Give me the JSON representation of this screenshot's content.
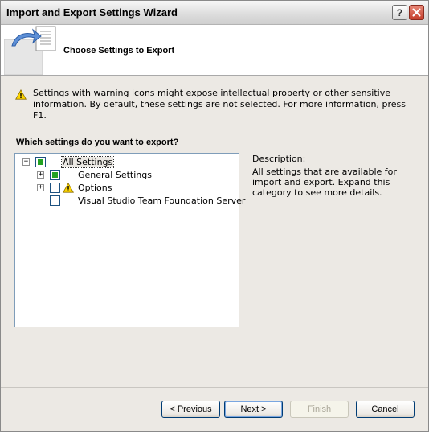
{
  "window": {
    "title": "Import and Export Settings Wizard"
  },
  "header": {
    "title": "Choose Settings to Export"
  },
  "warning": {
    "text": "Settings with warning icons might expose intellectual property or other sensitive information. By default, these settings are not selected. For more information, press F1."
  },
  "question": {
    "mnemonic": "W",
    "rest": "hich settings do you want to export?"
  },
  "tree": {
    "items": [
      {
        "label": "All Settings",
        "expander": "−",
        "check": "partial",
        "warning": false,
        "selected": true
      },
      {
        "label": "General Settings",
        "expander": "+",
        "check": "partial",
        "warning": false,
        "selected": false
      },
      {
        "label": "Options",
        "expander": "+",
        "check": "unchecked",
        "warning": true,
        "selected": false
      },
      {
        "label": "Visual Studio Team Foundation Server",
        "expander": "",
        "check": "unchecked",
        "warning": false,
        "selected": false
      }
    ]
  },
  "description": {
    "title": "Description:",
    "text": "All settings that are available for import and export. Expand this category to see more details."
  },
  "buttons": {
    "previous": {
      "prefix": "< ",
      "mnemonic": "P",
      "rest": "revious"
    },
    "next": {
      "mnemonic": "N",
      "rest": "ext >"
    },
    "finish": {
      "mnemonic": "F",
      "rest": "inish"
    },
    "cancel": {
      "label": "Cancel"
    }
  },
  "colors": {
    "accent_border": "#003c74",
    "check_fill": "#21a121",
    "warning": "#ffd700",
    "close_red": "#c43d2a"
  },
  "icons": {
    "help": "question-icon",
    "close": "close-icon",
    "warning": "warning-icon",
    "header": "export-document-icon"
  }
}
